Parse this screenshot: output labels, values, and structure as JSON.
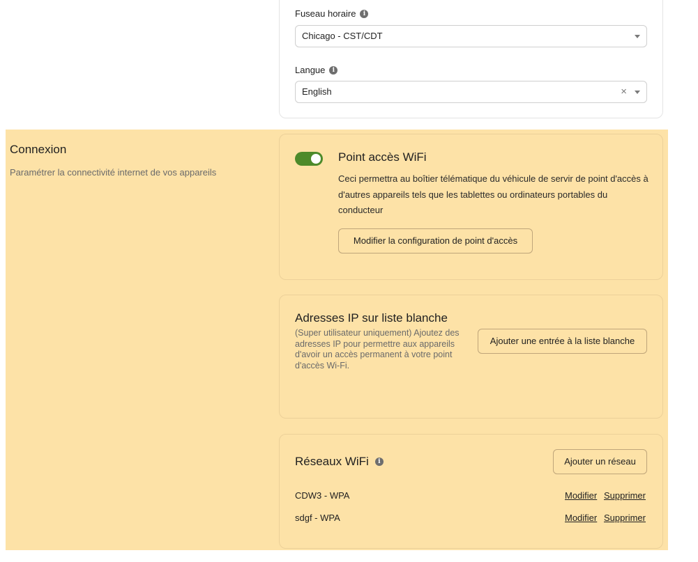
{
  "general": {
    "timezone": {
      "label": "Fuseau horaire",
      "value": "Chicago - CST/CDT"
    },
    "language": {
      "label": "Langue",
      "value": "English",
      "clear_glyph": "×"
    }
  },
  "connection": {
    "title": "Connexion",
    "description": "Paramétrer la connectivité internet de vos appareils",
    "hotspot": {
      "enabled": true,
      "title": "Point accès WiFi",
      "description": "Ceci permettra au boîtier télématique du véhicule de servir de point d'accès à d'autres appareils tels que les tablettes ou ordinateurs portables du conducteur",
      "configure_button": "Modifier la configuration de point d'accès"
    },
    "whitelist": {
      "title": "Adresses IP sur liste blanche",
      "description": "(Super utilisateur uniquement) Ajoutez des adresses IP pour permettre aux appareils d'avoir un accès permanent à votre point d'accès Wi-Fi.",
      "add_button": "Ajouter une entrée à la liste blanche"
    },
    "networks": {
      "title": "Réseaux WiFi",
      "add_button": "Ajouter un réseau",
      "items": [
        {
          "name": "CDW3 - WPA",
          "edit": "Modifier",
          "delete": "Supprimer"
        },
        {
          "name": "sdgf - WPA",
          "edit": "Modifier",
          "delete": "Supprimer"
        }
      ]
    }
  },
  "icons": {
    "info": "i"
  },
  "colors": {
    "highlight": "#fde2a7",
    "toggle_on": "#4d8a2a"
  }
}
